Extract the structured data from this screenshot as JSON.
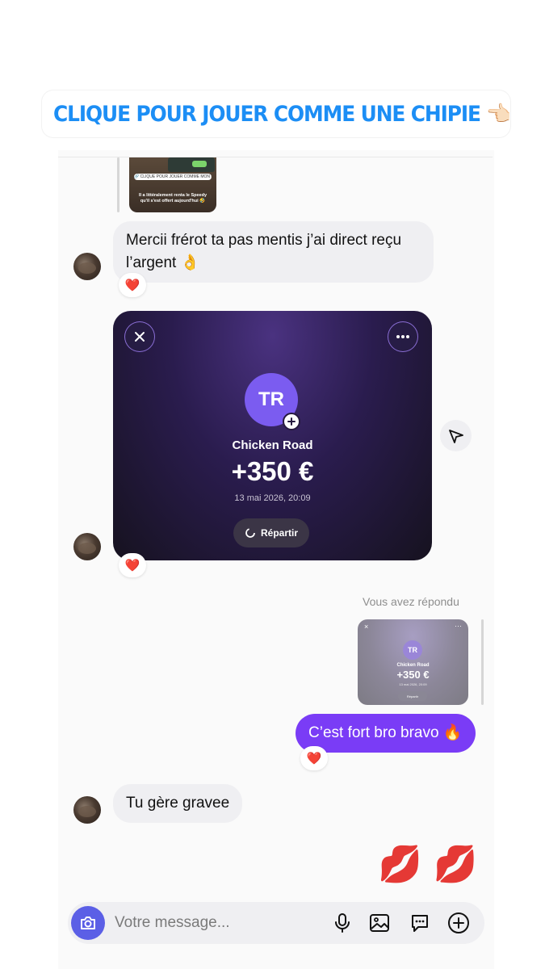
{
  "sticker": {
    "text": "CLIQUE POUR JOUER COMME UNE CHIPIE 👈🏻",
    "icon": "link-icon"
  },
  "story_reply": {
    "pill_text": "🔗 CLIQUE POUR JOUER COMME MON MARI !! 🔥",
    "caption": "Il a littéralement renta le Speedy qu'il s'est offert aujourd'hui 🤣"
  },
  "messages": {
    "m1": {
      "text": "Mercii frérot ta pas mentis j’ai direct reçu l’argent 👌",
      "reaction": "❤️"
    },
    "payment_card": {
      "initials": "TR",
      "name": "Chicken Road",
      "amount": "+350 €",
      "date": "13 mai 2026, 20:09",
      "button_label": "Répartir",
      "reaction": "❤️"
    },
    "reply_label": "Vous avez répondu",
    "mini_card": {
      "initials": "TR",
      "name": "Chicken Road",
      "amount": "+350 €",
      "date": "13 mai 2026, 20:09",
      "button_label": "Répartir"
    },
    "m2": {
      "text": "C’est fort bro bravo 🔥",
      "reaction": "❤️"
    },
    "m3": {
      "text": "Tu gère gravee"
    },
    "kisses": [
      "💋",
      "💋"
    ]
  },
  "composer": {
    "placeholder": "Votre message..."
  },
  "colors": {
    "accent": "#7a3cf6",
    "link": "#1c8ef5",
    "camera": "#5b5fe6"
  }
}
